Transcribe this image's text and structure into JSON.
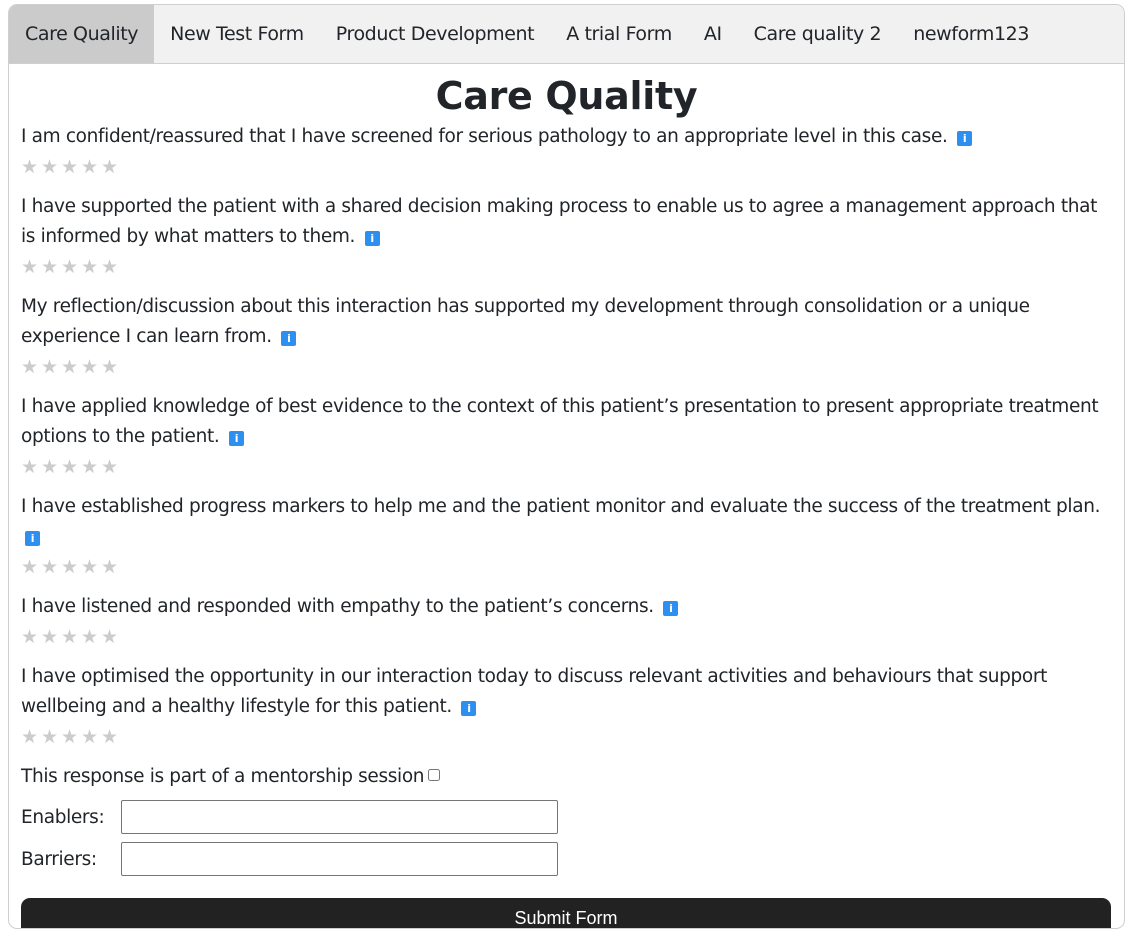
{
  "tabs": [
    {
      "label": "Care Quality",
      "active": true
    },
    {
      "label": "New Test Form",
      "active": false
    },
    {
      "label": "Product Development",
      "active": false
    },
    {
      "label": "A trial Form",
      "active": false
    },
    {
      "label": "AI",
      "active": false
    },
    {
      "label": "Care quality 2",
      "active": false
    },
    {
      "label": "newform123",
      "active": false
    }
  ],
  "form": {
    "title": "Care Quality",
    "questions": [
      {
        "text": "I am confident/reassured that I have screened for serious pathology to an appropriate level in this case.",
        "rating": 0,
        "max_rating": 5
      },
      {
        "text": "I have supported the patient with a shared decision making process to enable us to agree a management approach that is informed by what matters to them.",
        "rating": 0,
        "max_rating": 5
      },
      {
        "text": "My reflection/discussion about this interaction has supported my development through consolidation or a unique experience I can learn from.",
        "rating": 0,
        "max_rating": 5
      },
      {
        "text": "I have applied knowledge of best evidence to the context of this patient’s presentation to present appropriate treatment options to the patient.",
        "rating": 0,
        "max_rating": 5
      },
      {
        "text": "I have established progress markers to help me and the patient monitor and evaluate the success of the treatment plan.",
        "rating": 0,
        "max_rating": 5
      },
      {
        "text": "I have listened and responded with empathy to the patient’s concerns.",
        "rating": 0,
        "max_rating": 5
      },
      {
        "text": "I have optimised the opportunity in our interaction today to discuss relevant activities and behaviours that support wellbeing and a healthy lifestyle for this patient.",
        "rating": 0,
        "max_rating": 5
      }
    ],
    "info_icon": "i",
    "star_glyph": "★",
    "mentorship_label": "This response is part of a mentorship session",
    "mentorship_checked": false,
    "enablers_label": "Enablers:",
    "enablers_value": "",
    "barriers_label": "Barriers:",
    "barriers_value": "",
    "submit_label": "Submit Form"
  },
  "colors": {
    "active_tab": "#cbcbcb",
    "tabbar": "#f1f1f1",
    "info_icon": "#2d8ff0",
    "star_empty": "#cccccc",
    "submit_bg": "#222222"
  }
}
